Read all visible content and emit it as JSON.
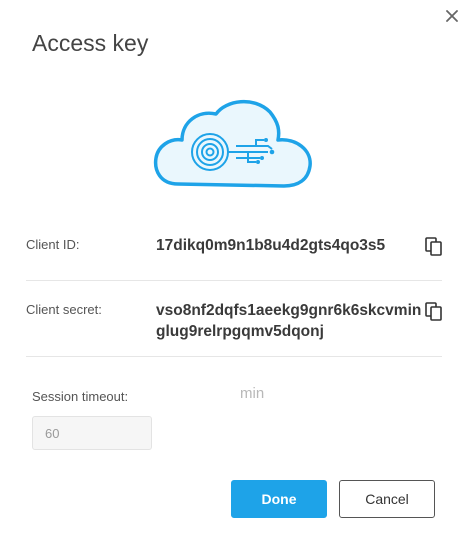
{
  "dialog": {
    "title": "Access key",
    "close_icon": "close-icon"
  },
  "illustration": {
    "icon": "cloud-key-icon",
    "colors": {
      "outline": "#1ea3e8",
      "fill": "#eaf7fd"
    }
  },
  "client_id": {
    "label": "Client ID:",
    "value": "17dikq0m9n1b8u4d2gts4qo3s5",
    "copy_icon": "copy-icon"
  },
  "client_secret": {
    "label": "Client secret:",
    "value": "vso8nf2dqfs1aeekg9gnr6k6skcvminglug9relrpgqmv5dqonj",
    "copy_icon": "copy-icon"
  },
  "session_timeout": {
    "label": "Session timeout:",
    "value": "60",
    "unit": "min"
  },
  "actions": {
    "done_label": "Done",
    "cancel_label": "Cancel"
  },
  "colors": {
    "accent": "#1ea3e8",
    "text": "#333333"
  }
}
